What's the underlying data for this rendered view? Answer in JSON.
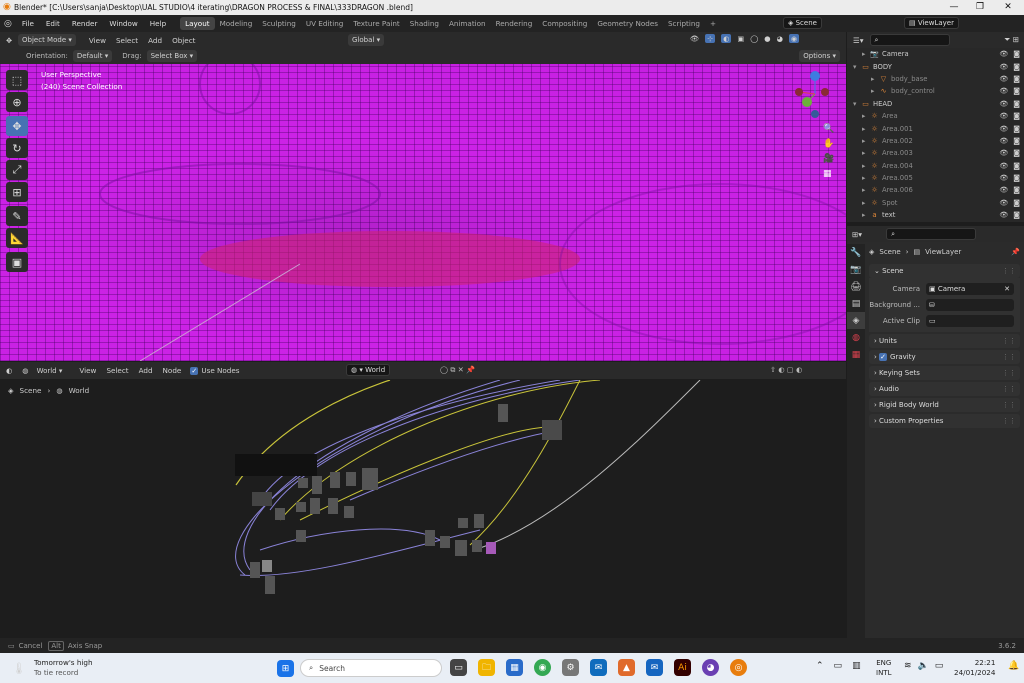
{
  "window": {
    "title": "Blender* [C:\\Users\\sanja\\Desktop\\UAL STUDIO\\4 iterating\\DRAGON PROCESS & FINAL\\333DRAGON .blend]"
  },
  "menu": [
    "File",
    "Edit",
    "Render",
    "Window",
    "Help"
  ],
  "workspaces": [
    "Layout",
    "Modeling",
    "Sculpting",
    "UV Editing",
    "Texture Paint",
    "Shading",
    "Animation",
    "Rendering",
    "Compositing",
    "Geometry Nodes",
    "Scripting"
  ],
  "active_workspace": "Layout",
  "scene_field": "Scene",
  "viewlayer_field": "ViewLayer",
  "viewport_header": {
    "mode": "Object Mode",
    "menus": [
      "View",
      "Select",
      "Add",
      "Object"
    ],
    "transform": "Global"
  },
  "viewport_header2": {
    "orientation_label": "Orientation:",
    "orientation_value": "Default",
    "drag_label": "Drag:",
    "drag_value": "Select Box",
    "options": "Options"
  },
  "viewport_overlay": {
    "line1": "User Perspective",
    "line2": "(240) Scene Collection"
  },
  "node_header": {
    "type": "World",
    "menus": [
      "View",
      "Select",
      "Add",
      "Node"
    ],
    "use_nodes": "Use Nodes",
    "world_name": "World"
  },
  "breadcrumb": [
    "Scene",
    "World"
  ],
  "status": {
    "cancel": "Cancel",
    "alt_key": "Alt",
    "axis_snap": "Axis Snap",
    "version": "3.6.2"
  },
  "outliner": [
    {
      "label": "Camera",
      "indent": 1,
      "icon": "camera-icon",
      "dim": false
    },
    {
      "label": "BODY",
      "indent": 0,
      "icon": "collection-icon",
      "dim": false
    },
    {
      "label": "body_base",
      "indent": 2,
      "icon": "mesh-icon",
      "dim": true
    },
    {
      "label": "body_control",
      "indent": 2,
      "icon": "curve-icon",
      "dim": true
    },
    {
      "label": "HEAD",
      "indent": 0,
      "icon": "collection-icon",
      "dim": false
    },
    {
      "label": "Area",
      "indent": 1,
      "icon": "light-icon",
      "dim": true
    },
    {
      "label": "Area.001",
      "indent": 1,
      "icon": "light-icon",
      "dim": true
    },
    {
      "label": "Area.002",
      "indent": 1,
      "icon": "light-icon",
      "dim": true
    },
    {
      "label": "Area.003",
      "indent": 1,
      "icon": "light-icon",
      "dim": true
    },
    {
      "label": "Area.004",
      "indent": 1,
      "icon": "light-icon",
      "dim": true
    },
    {
      "label": "Area.005",
      "indent": 1,
      "icon": "light-icon",
      "dim": true
    },
    {
      "label": "Area.006",
      "indent": 1,
      "icon": "light-icon",
      "dim": true
    },
    {
      "label": "Spot",
      "indent": 1,
      "icon": "light-icon",
      "dim": true
    },
    {
      "label": "text",
      "indent": 1,
      "icon": "text-icon",
      "dim": false
    }
  ],
  "properties": {
    "breadcrumb": [
      "Scene",
      "ViewLayer"
    ],
    "section": "Scene",
    "camera_label": "Camera",
    "camera_value": "Camera",
    "background_label": "Background ...",
    "active_clip_label": "Active Clip",
    "panels": [
      "Units",
      "Gravity",
      "Keying Sets",
      "Audio",
      "Rigid Body World",
      "Custom Properties"
    ]
  },
  "taskbar": {
    "weather1": "Tomorrow's high",
    "weather2": "To tie record",
    "search": "Search",
    "lang1": "ENG",
    "lang2": "INTL",
    "time": "22:21",
    "date": "24/01/2024"
  },
  "colors": {
    "accent": "#4772b3",
    "viewport": "#c41fe0"
  }
}
